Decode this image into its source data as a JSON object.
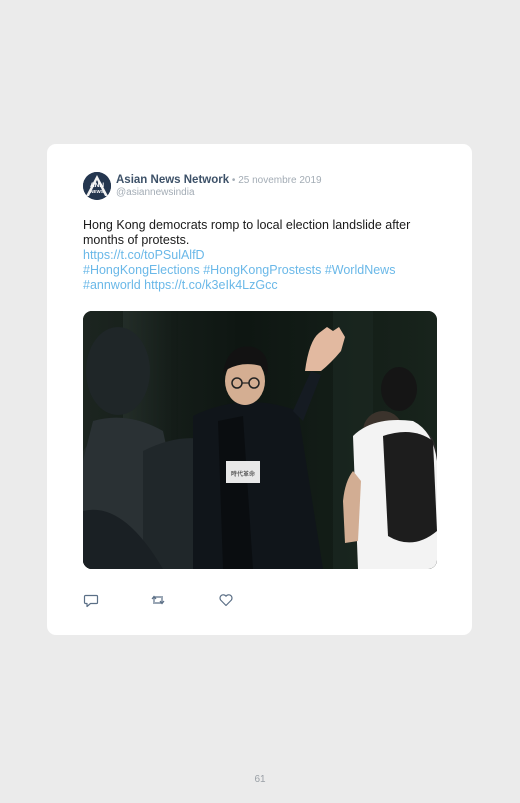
{
  "tweet": {
    "author_name": "Asian News Network",
    "date_separator": " • ",
    "date": "25 novembre 2019",
    "handle": "@asiannewsindia",
    "text": "Hong Kong democrats romp to local election landslide after months of protests.",
    "link1": "https://t.co/toPSulAlfD",
    "hashtags": "#HongKongElections #HongKongProstests #WorldNews",
    "hashtag_last": "#annworld",
    "link2": "https://t.co/k3eIk4LzGcc",
    "avatar_text_top": "ANN",
    "avatar_text_bottom": "NEWS",
    "photo_sign": "時代革命"
  },
  "actions": [
    {
      "name": "reply",
      "icon": "comment-icon"
    },
    {
      "name": "retweet",
      "icon": "retweet-icon"
    },
    {
      "name": "like",
      "icon": "heart-icon"
    }
  ],
  "page": {
    "number": "61"
  },
  "colors": {
    "background": "#ebebeb",
    "card": "#ffffff",
    "author": "#3d5168",
    "muted": "#a3acb5",
    "link": "#6ab8e8",
    "icon": "#5b6f86"
  }
}
